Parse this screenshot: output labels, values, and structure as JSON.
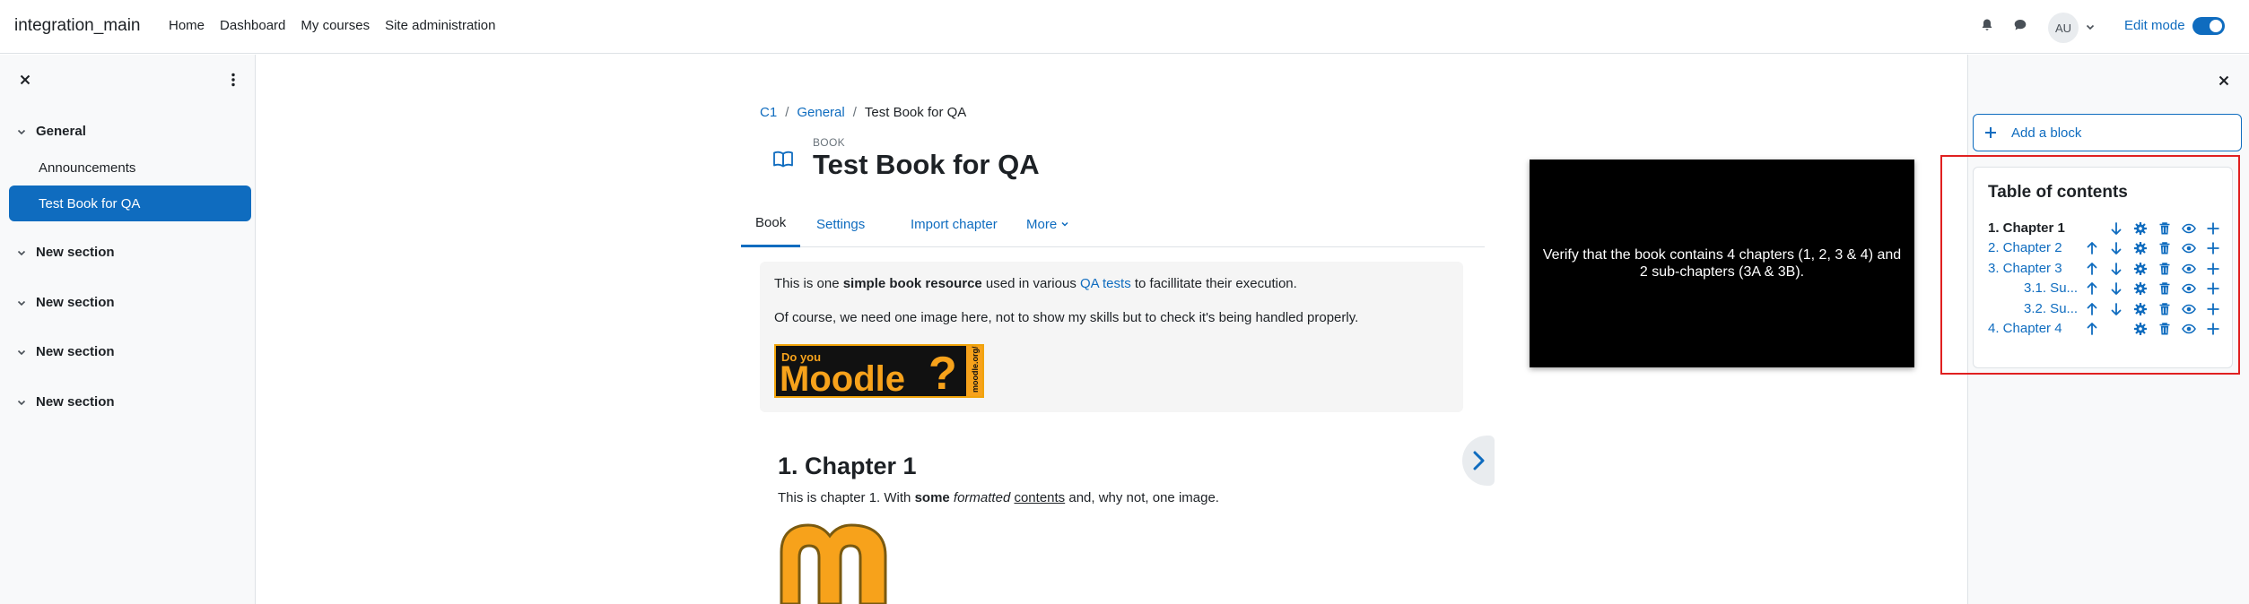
{
  "navbar": {
    "site_name": "integration_main",
    "links": [
      "Home",
      "Dashboard",
      "My courses",
      "Site administration"
    ],
    "user_initials": "AU",
    "edit_mode_label": "Edit mode",
    "edit_mode_on": true,
    "icons": [
      "bell-icon",
      "chat-bubble-icon",
      "chevron-down-icon"
    ]
  },
  "course_index": {
    "sections": [
      {
        "title": "General",
        "expanded": true,
        "items": [
          {
            "label": "Announcements",
            "active": false
          },
          {
            "label": "Test Book for QA",
            "active": true
          }
        ]
      },
      {
        "title": "New section",
        "expanded": false
      },
      {
        "title": "New section",
        "expanded": false
      },
      {
        "title": "New section",
        "expanded": false
      },
      {
        "title": "New section",
        "expanded": false
      }
    ]
  },
  "breadcrumb": [
    "C1",
    "General",
    "Test Book for QA"
  ],
  "page": {
    "kicker": "BOOK",
    "title": "Test Book for QA",
    "tabs": [
      {
        "label": "Book",
        "active": true
      },
      {
        "label": "Settings"
      },
      {
        "label": "Import chapter"
      },
      {
        "label": "More"
      }
    ],
    "intro": {
      "p1_before": "This is one ",
      "p1_bold": "simple book resource",
      "p1_middle": " used in various ",
      "p1_link": "QA tests",
      "p1_after": " to facillitate their execution.",
      "p2": "Of course, we need one image here, not to show my skills but to check it's being handled properly.",
      "banner_text": "Do you Moodle?",
      "banner_side": "moodle.org/do"
    },
    "chapter": {
      "title": "1. Chapter 1",
      "text_1": "This is chapter 1. With ",
      "text_bold": "some",
      "text_italic": "formatted",
      "text_underline": "contents",
      "text_end": " and, why not, one image."
    }
  },
  "qa_note": "Verify that the book contains 4 chapters (1, 2, 3 & 4) and 2 sub-chapters (3A & 3B).",
  "blocks": {
    "add_block_label": "Add a block",
    "toc": {
      "heading": "Table of contents",
      "entries": [
        {
          "label": "1. Chapter 1",
          "current": true,
          "actions": [
            "down",
            "edit",
            "delete",
            "hide",
            "add"
          ]
        },
        {
          "label": "2. Chapter 2",
          "actions": [
            "up",
            "down",
            "edit",
            "delete",
            "hide",
            "add"
          ]
        },
        {
          "label": "3. Chapter 3",
          "actions": [
            "up",
            "down",
            "edit",
            "delete",
            "hide",
            "add"
          ]
        },
        {
          "label": "3.1. Su...",
          "actions": [
            "up",
            "down",
            "edit",
            "delete",
            "hide",
            "add"
          ]
        },
        {
          "label": "3.2. Su...",
          "actions": [
            "up",
            "down",
            "edit",
            "delete",
            "hide",
            "add"
          ]
        },
        {
          "label": "4. Chapter 4",
          "actions": [
            "up",
            "edit",
            "delete",
            "hide",
            "add"
          ]
        }
      ]
    }
  },
  "colors": {
    "accent": "#0f6cbf",
    "highlight": "#e02020",
    "note_bg": "#000000",
    "moodle_orange": "#f7a21b"
  }
}
